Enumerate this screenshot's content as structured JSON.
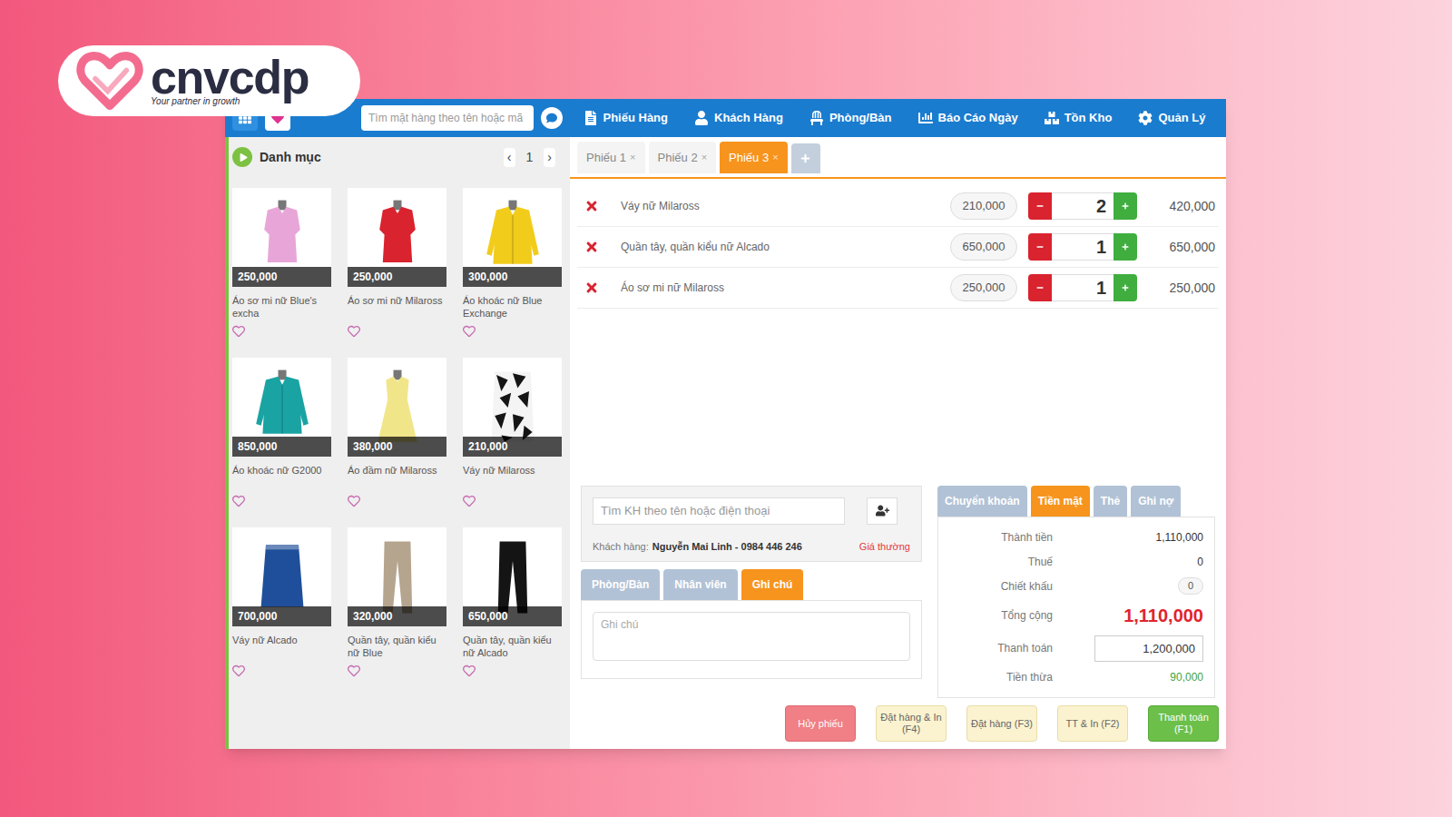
{
  "logo": {
    "name": "cnvcdp",
    "tagline": "Your partner in growth"
  },
  "search": {
    "placeholder": "Tìm mặt hàng theo tên hoặc mã"
  },
  "nav": [
    "Phiếu Hàng",
    "Khách Hàng",
    "Phòng/Bàn",
    "Báo Cáo Ngày",
    "Tồn Kho",
    "Quản Lý"
  ],
  "category": {
    "title": "Danh mục",
    "prev": "‹",
    "page": "1",
    "next": "›"
  },
  "products": [
    {
      "name": "Áo sơ mi nữ Blue's excha",
      "price": "250,000",
      "kind": "top",
      "color": "#e8a6d8"
    },
    {
      "name": "Áo sơ mi nữ Milaross",
      "price": "250,000",
      "kind": "top",
      "color": "#d9232e"
    },
    {
      "name": "Áo khoác nữ Blue Exchange",
      "price": "300,000",
      "kind": "jacket",
      "color": "#f2cc1b"
    },
    {
      "name": "Áo khoác nữ G2000",
      "price": "850,000",
      "kind": "jacket",
      "color": "#1aa3a3"
    },
    {
      "name": "Áo đầm nữ Milaross",
      "price": "380,000",
      "kind": "dress",
      "color": "#f1e58a"
    },
    {
      "name": "Váy nữ Milaross",
      "price": "210,000",
      "kind": "patterned-skirt",
      "color": "#151515"
    },
    {
      "name": "Váy nữ Alcado",
      "price": "700,000",
      "kind": "skirt",
      "color": "#1f4f9a"
    },
    {
      "name": "Quần tây, quần kiểu nữ Blue",
      "price": "320,000",
      "kind": "pants",
      "color": "#b5a48e"
    },
    {
      "name": "Quần tây, quần kiểu nữ Alcado",
      "price": "650,000",
      "kind": "pants",
      "color": "#141414"
    }
  ],
  "ticket_tabs": [
    {
      "label": "Phiếu 1",
      "close": "×",
      "selected": false
    },
    {
      "label": "Phiếu 2",
      "close": "×",
      "selected": false
    },
    {
      "label": "Phiếu 3",
      "close": "×",
      "selected": true
    }
  ],
  "order_lines": [
    {
      "name": "Váy nữ Milaross",
      "price": "210,000",
      "qty": "2",
      "total": "420,000"
    },
    {
      "name": "Quần tây, quần kiểu nữ Alcado",
      "price": "650,000",
      "qty": "1",
      "total": "650,000"
    },
    {
      "name": "Áo sơ mi nữ Milaross",
      "price": "250,000",
      "qty": "1",
      "total": "250,000"
    }
  ],
  "customer": {
    "placeholder": "Tìm KH theo tên hoặc điện thoại",
    "label": "Khách hàng:",
    "value": "Nguyễn Mai Linh - 0984 446 246",
    "price_level": "Giá thường"
  },
  "info_tabs": [
    {
      "label": "Phòng/Bàn",
      "selected": false
    },
    {
      "label": "Nhân viên",
      "selected": false
    },
    {
      "label": "Ghi chú",
      "selected": true
    }
  ],
  "note": {
    "placeholder": "Ghi chú"
  },
  "payment_tabs": [
    {
      "label": "Chuyển khoản",
      "selected": false
    },
    {
      "label": "Tiền mặt",
      "selected": true
    },
    {
      "label": "Thẻ",
      "selected": false
    },
    {
      "label": "Ghi nợ",
      "selected": false
    }
  ],
  "summary": [
    {
      "label": "Thành tiền",
      "value": "1,110,000",
      "kind": "plain"
    },
    {
      "label": "Thuế",
      "value": "0",
      "kind": "plain"
    },
    {
      "label": "Chiết khấu",
      "value": "0",
      "kind": "pill"
    },
    {
      "label": "Tổng cộng",
      "value": "1,110,000",
      "kind": "total"
    },
    {
      "label": "Thanh toán",
      "value": "1,200,000",
      "kind": "input"
    },
    {
      "label": "Tiền thừa",
      "value": "90,000",
      "kind": "change"
    }
  ],
  "buttons": [
    {
      "label": "Hủy phiếu",
      "kind": "cancel"
    },
    {
      "label": "Đặt hàng & In (F4)",
      "kind": "secondary"
    },
    {
      "label": "Đặt hàng (F3)",
      "kind": "secondary"
    },
    {
      "label": "TT & In (F2)",
      "kind": "secondary"
    },
    {
      "label": "Thanh toán (F1)",
      "kind": "primary"
    }
  ]
}
